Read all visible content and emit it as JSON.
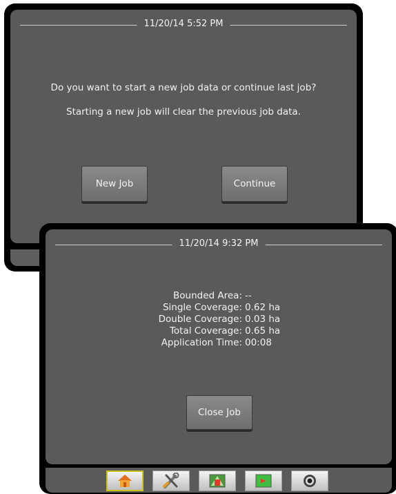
{
  "new_job_dialog": {
    "datetime": "11/20/14 5:52 PM",
    "question": "Do you want to start a new job data or continue last job?",
    "warning": "Starting a new job will clear the previous job data.",
    "new_job_label": "New Job",
    "continue_label": "Continue"
  },
  "close_job_screen": {
    "datetime": "11/20/14 9:32 PM",
    "stats": [
      {
        "label": "Bounded Area:",
        "value": "--"
      },
      {
        "label": "Single Coverage:",
        "value": "0.62 ha"
      },
      {
        "label": "Double Coverage:",
        "value": "0.03 ha"
      },
      {
        "label": "Total Coverage:",
        "value": "0.65 ha"
      },
      {
        "label": "Application Time:",
        "value": "00:08"
      }
    ],
    "close_job_label": "Close Job"
  },
  "nav_tabs": [
    {
      "icon": "home-icon",
      "active": true
    },
    {
      "icon": "tools-icon",
      "active": false
    },
    {
      "icon": "vehicle-view-icon",
      "active": false
    },
    {
      "icon": "map-icon",
      "active": false
    },
    {
      "icon": "camera-icon",
      "active": false
    }
  ],
  "colors": {
    "bezel": "#000000",
    "panel": "#5a5a5a",
    "active_tab_border": "#c8c41a"
  }
}
